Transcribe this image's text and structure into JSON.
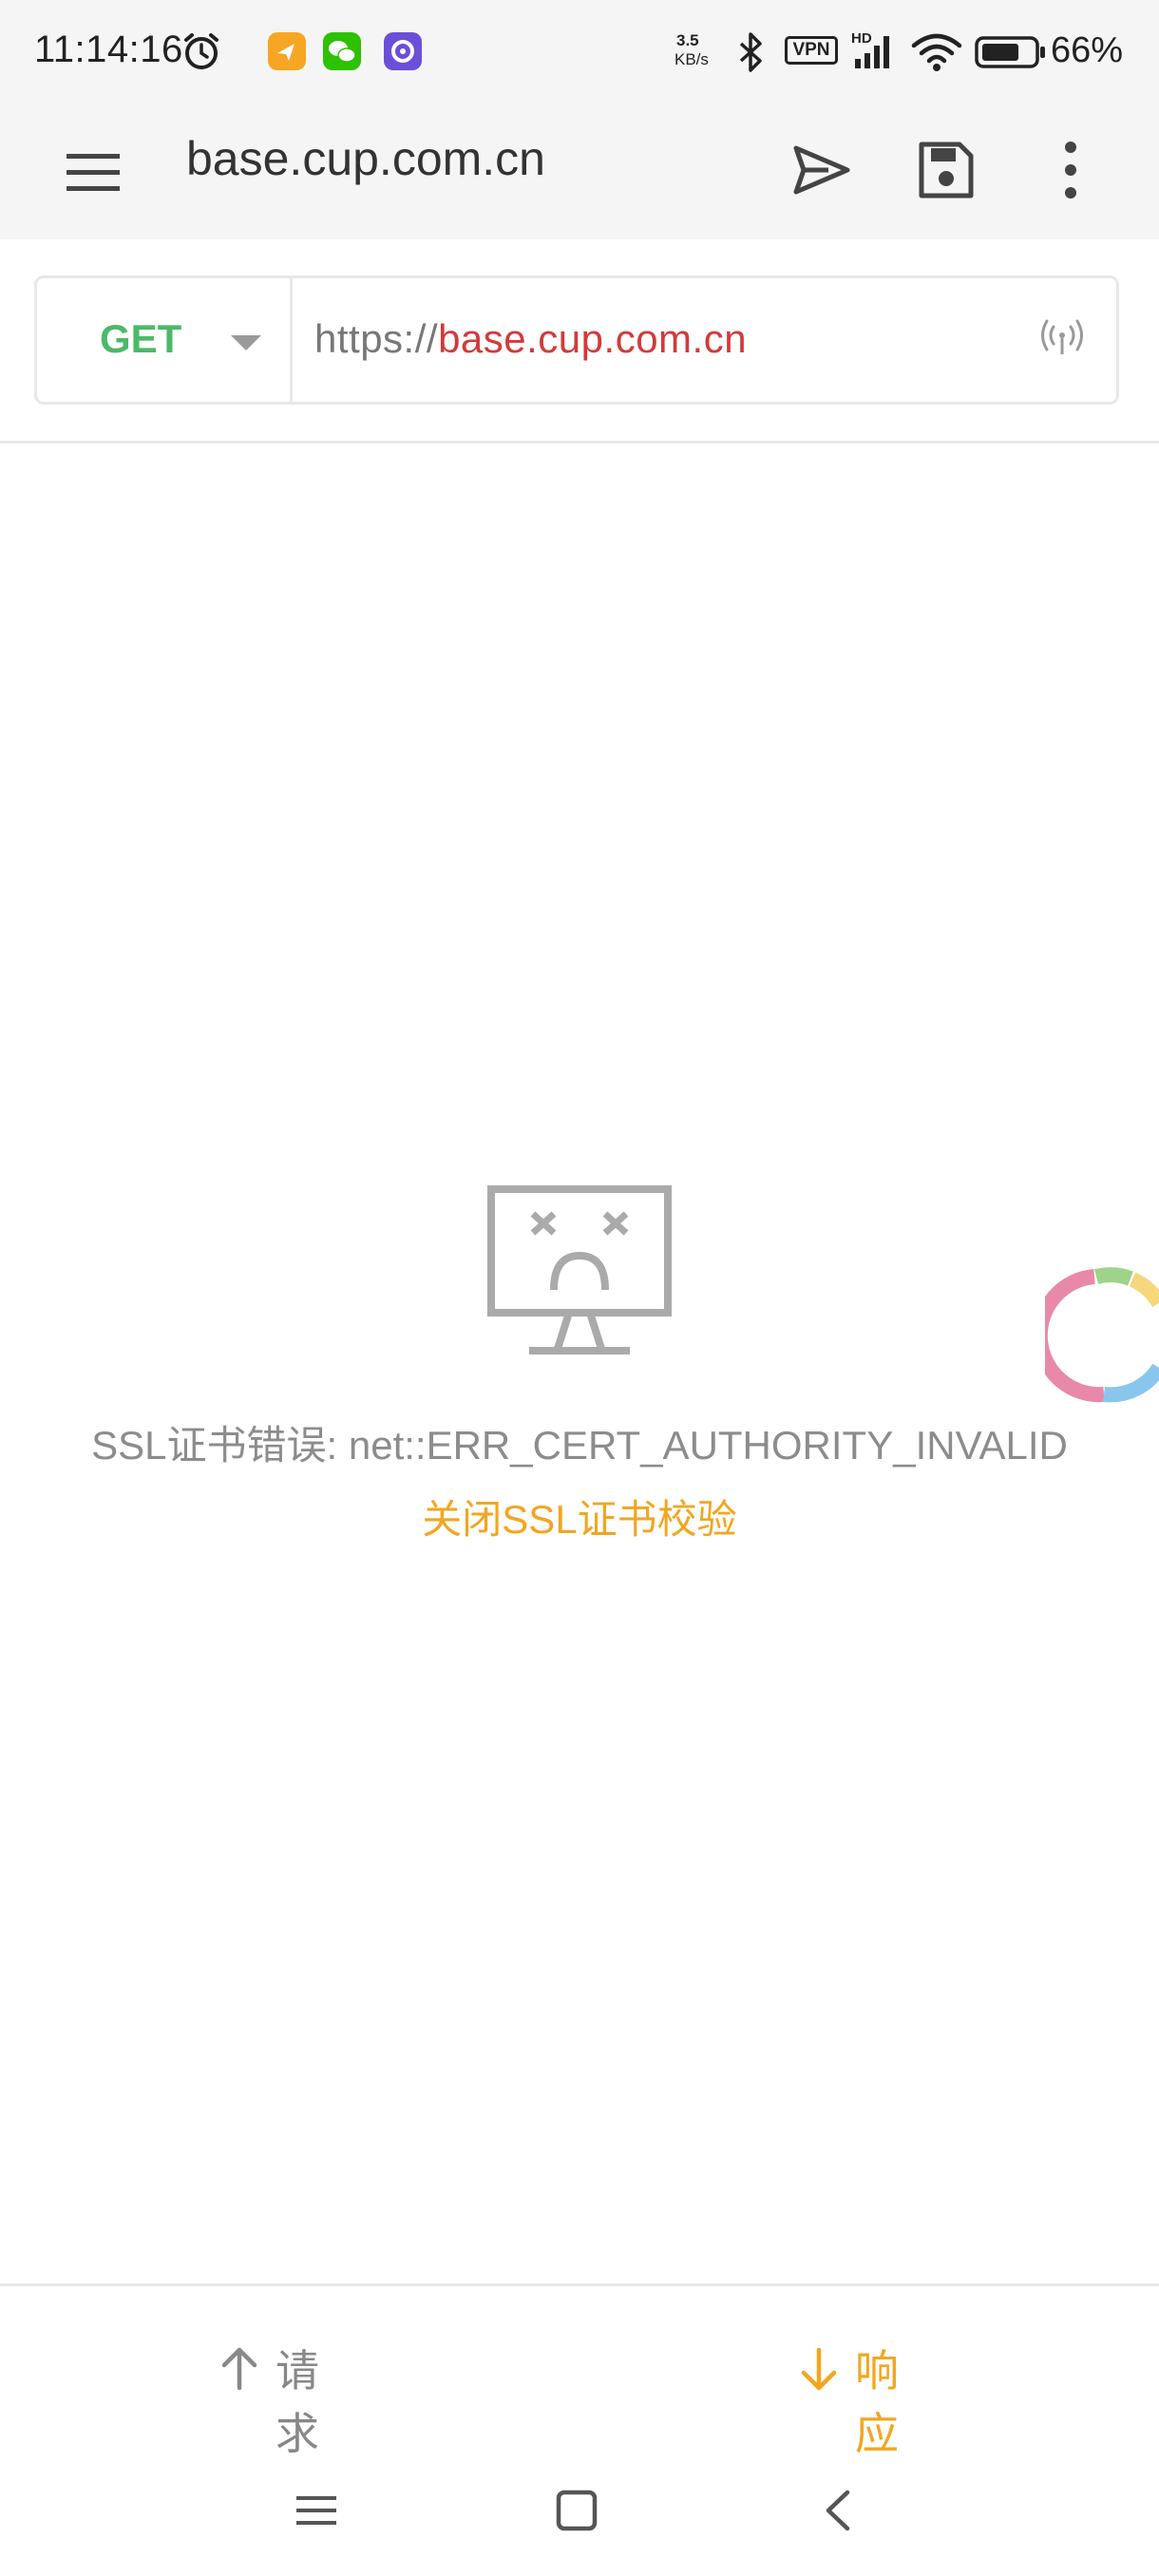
{
  "status_bar": {
    "time": "11:14:16",
    "net_speed_top": "3.5",
    "net_speed_bottom": "KB/s",
    "vpn_label": "VPN",
    "hd_label": "HD",
    "battery_percent": "66%",
    "icons": [
      "alarm-icon",
      "app-badge-orange",
      "wechat-icon",
      "app-badge-purple",
      "bluetooth-icon",
      "vpn-icon",
      "signal-icon",
      "wifi-icon",
      "battery-icon"
    ]
  },
  "toolbar": {
    "title": "base.cup.com.cn",
    "icons": [
      "menu-icon",
      "send-icon",
      "save-icon",
      "more-icon"
    ]
  },
  "request": {
    "method": "GET",
    "url_protocol": "https://",
    "url_host": "base.cup.com.cn"
  },
  "error": {
    "message": "SSL证书错误: net::ERR_CERT_AUTHORITY_INVALID",
    "action": "关闭SSL证书校验"
  },
  "tabs": {
    "request_label": "请求",
    "response_label": "响应"
  },
  "colors": {
    "accent": "#f2a620",
    "method": "#4cb968",
    "host": "#d23a3a"
  }
}
